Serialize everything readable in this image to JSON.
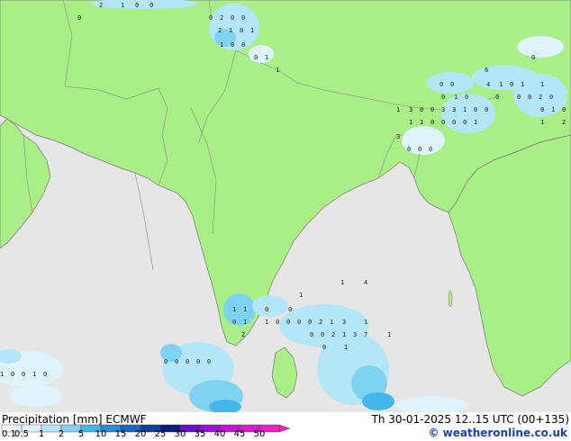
{
  "map": {
    "colors": {
      "sea": "#e6e6e6",
      "land": "#aaee88",
      "border": "#777777"
    },
    "precip_numbers": [
      {
        "v": "0"
      },
      {
        "v": "2"
      },
      {
        "v": "1"
      },
      {
        "v": "0"
      },
      {
        "v": "0"
      },
      {
        "v": "0"
      },
      {
        "v": "2"
      },
      {
        "v": "0"
      },
      {
        "v": "0"
      },
      {
        "v": "2"
      },
      {
        "v": "1"
      },
      {
        "v": "0"
      },
      {
        "v": "1"
      },
      {
        "v": "1"
      },
      {
        "v": "0"
      },
      {
        "v": "0"
      },
      {
        "v": "0"
      },
      {
        "v": "1"
      },
      {
        "v": "1"
      },
      {
        "v": "6"
      },
      {
        "v": "4"
      },
      {
        "v": "1"
      },
      {
        "v": "0"
      },
      {
        "v": "1"
      },
      {
        "v": "0"
      },
      {
        "v": "1"
      },
      {
        "v": "0"
      },
      {
        "v": "0"
      },
      {
        "v": "0"
      },
      {
        "v": "1"
      },
      {
        "v": "0"
      },
      {
        "v": "0"
      },
      {
        "v": "0"
      },
      {
        "v": "0"
      },
      {
        "v": "2"
      },
      {
        "v": "0"
      },
      {
        "v": "1"
      },
      {
        "v": "3"
      },
      {
        "v": "0"
      },
      {
        "v": "0"
      },
      {
        "v": "3"
      },
      {
        "v": "3"
      },
      {
        "v": "1"
      },
      {
        "v": "0"
      },
      {
        "v": "0"
      },
      {
        "v": "0"
      },
      {
        "v": "1"
      },
      {
        "v": "0"
      },
      {
        "v": "1"
      },
      {
        "v": "1"
      },
      {
        "v": "0"
      },
      {
        "v": "0"
      },
      {
        "v": "0"
      },
      {
        "v": "0"
      },
      {
        "v": "1"
      },
      {
        "v": "1"
      },
      {
        "v": "2"
      },
      {
        "v": "3"
      },
      {
        "v": "0"
      },
      {
        "v": "0"
      },
      {
        "v": "0"
      },
      {
        "v": "1"
      },
      {
        "v": "4"
      },
      {
        "v": "1"
      },
      {
        "v": "1"
      },
      {
        "v": "0"
      },
      {
        "v": "0"
      },
      {
        "v": "1"
      },
      {
        "v": "0"
      },
      {
        "v": "1"
      },
      {
        "v": "1"
      },
      {
        "v": "0"
      },
      {
        "v": "0"
      },
      {
        "v": "0"
      },
      {
        "v": "0"
      },
      {
        "v": "2"
      },
      {
        "v": "1"
      },
      {
        "v": "3"
      },
      {
        "v": "1"
      },
      {
        "v": "2"
      },
      {
        "v": "0"
      },
      {
        "v": "0"
      },
      {
        "v": "2"
      },
      {
        "v": "1"
      },
      {
        "v": "3"
      },
      {
        "v": "7"
      },
      {
        "v": "1"
      },
      {
        "v": "0"
      },
      {
        "v": "1"
      },
      {
        "v": "0"
      },
      {
        "v": "0"
      },
      {
        "v": "0"
      },
      {
        "v": "0"
      },
      {
        "v": "0"
      },
      {
        "v": "1"
      },
      {
        "v": "0"
      },
      {
        "v": "0"
      },
      {
        "v": "1"
      },
      {
        "v": "0"
      },
      {
        "v": "1"
      },
      {
        "v": "3"
      }
    ]
  },
  "footer": {
    "title_left": "Precipitation [mm]  ECMWF",
    "title_right": "Th 30-01-2025 12..15 UTC (00+135)",
    "credit": "© weatheronline.co.uk",
    "scale": [
      {
        "label": "0.1",
        "color": "#f5fbfe"
      },
      {
        "label": "0.5",
        "color": "#dff3fb"
      },
      {
        "label": "1",
        "color": "#b4e6f7"
      },
      {
        "label": "2",
        "color": "#7fd2f1"
      },
      {
        "label": "5",
        "color": "#45b6ea"
      },
      {
        "label": "10",
        "color": "#2490d8"
      },
      {
        "label": "15",
        "color": "#1a66c0"
      },
      {
        "label": "20",
        "color": "#1040a0"
      },
      {
        "label": "25",
        "color": "#0a1c84"
      },
      {
        "label": "30",
        "color": "#6a10c8"
      },
      {
        "label": "35",
        "color": "#9a12d8"
      },
      {
        "label": "40",
        "color": "#c814d8"
      },
      {
        "label": "45",
        "color": "#e018d0"
      },
      {
        "label": "50",
        "color": "#f020c0"
      }
    ]
  }
}
